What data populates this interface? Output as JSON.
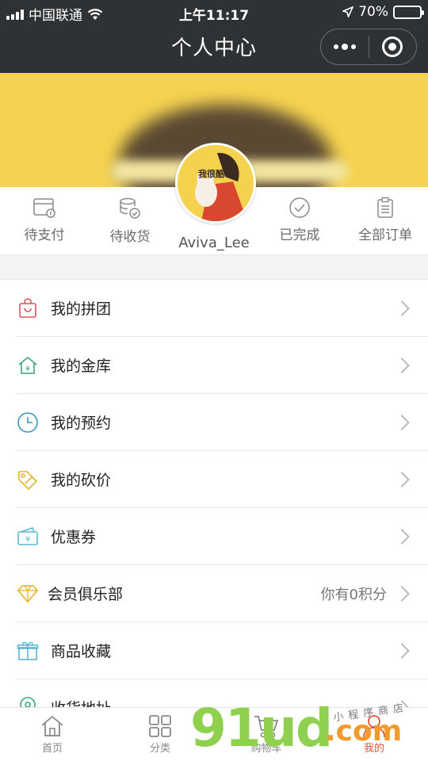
{
  "status_bar": {
    "carrier": "中国联通",
    "time": "上午11:17",
    "battery": "70%",
    "battery_level": 0.7
  },
  "nav": {
    "title": "个人中心"
  },
  "profile": {
    "username": "Aviva_Lee",
    "avatar_text": "我很酷啊"
  },
  "orders": [
    {
      "label": "待支付",
      "icon": "wallet-icon"
    },
    {
      "label": "待收货",
      "icon": "coins-icon"
    },
    {
      "label": "已完成",
      "icon": "check-circle-icon"
    },
    {
      "label": "全部订单",
      "icon": "clipboard-icon"
    }
  ],
  "menu": [
    {
      "label": "我的拼团",
      "icon": "shopping-bag-icon",
      "extra": ""
    },
    {
      "label": "我的金库",
      "icon": "vault-house-icon",
      "extra": ""
    },
    {
      "label": "我的预约",
      "icon": "clock-icon",
      "extra": ""
    },
    {
      "label": "我的砍价",
      "icon": "price-tag-icon",
      "extra": ""
    },
    {
      "label": "优惠券",
      "icon": "coupon-icon",
      "extra": ""
    },
    {
      "label": "会员俱乐部",
      "icon": "diamond-icon",
      "extra": "你有0积分"
    },
    {
      "label": "商品收藏",
      "icon": "gift-icon",
      "extra": ""
    },
    {
      "label": "收货地址",
      "icon": "location-icon",
      "extra": ""
    }
  ],
  "tabs": [
    {
      "label": "首页",
      "icon": "home-icon"
    },
    {
      "label": "分类",
      "icon": "grid-icon"
    },
    {
      "label": "购物车",
      "icon": "cart-icon"
    },
    {
      "label": "我的",
      "icon": "user-icon"
    }
  ],
  "watermark": {
    "main": "91ud",
    "suffix": ".com",
    "tagline": "小程序商店"
  },
  "colors": {
    "nav_bg": "#2f3235",
    "banner": "#f5d350",
    "active_tab": "#e4543c"
  }
}
